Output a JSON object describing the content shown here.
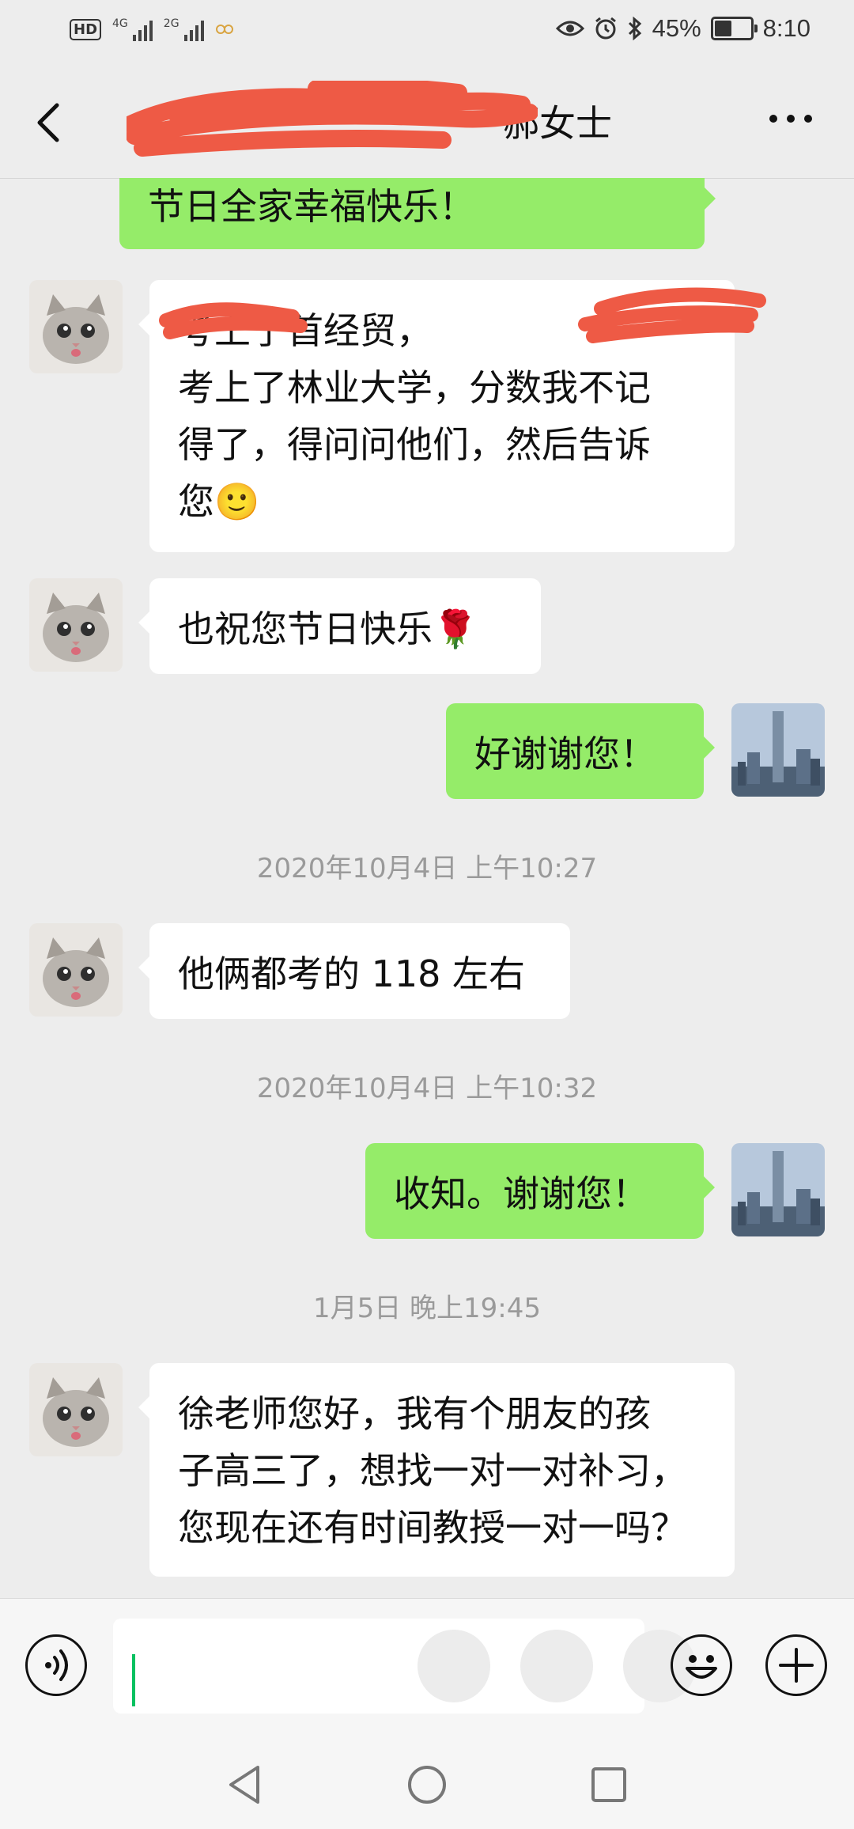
{
  "status_bar": {
    "hd_label": "HD",
    "net1": "4G",
    "net2": "2G",
    "battery_percent": "45%",
    "time": "8:10"
  },
  "header": {
    "title_visible": "郝女士"
  },
  "messages": [
    {
      "side": "out",
      "text": "节日全家幸福快乐！"
    },
    {
      "side": "in",
      "text": "考上了首经贸，\n考上了林业大学，分数我不记\n得了，得问问他们，然后告诉\n您🙂"
    },
    {
      "side": "in",
      "text": "也祝您节日快乐🌹"
    },
    {
      "side": "out",
      "text": "好谢谢您！"
    },
    {
      "side": "time",
      "text": "2020年10月4日 上午10:27"
    },
    {
      "side": "in",
      "text": "他俩都考的 118 左右"
    },
    {
      "side": "time",
      "text": "2020年10月4日 上午10:32"
    },
    {
      "side": "out",
      "text": "收知。谢谢您！"
    },
    {
      "side": "time",
      "text": "1月5日 晚上19:45"
    },
    {
      "side": "in",
      "text": "徐老师您好，我有个朋友的孩\n子高三了，想找一对一对补习，\n您现在还有时间教授一对一吗？"
    }
  ],
  "input": {
    "value": "",
    "placeholder": ""
  },
  "colors": {
    "outgoing_bubble": "#95ec69",
    "incoming_bubble": "#ffffff",
    "caret": "#07c160",
    "redaction": "#ee5a45"
  }
}
